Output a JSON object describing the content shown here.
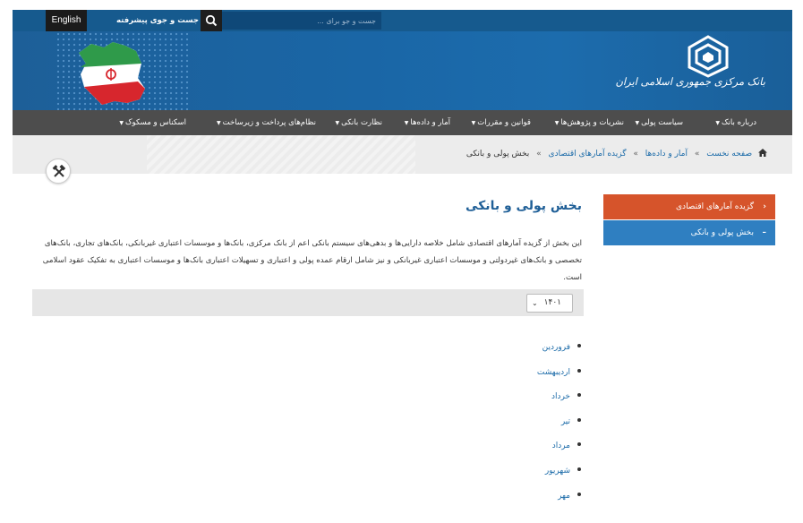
{
  "topbar": {
    "language_label": "English",
    "advanced_search_label": "جست و جوی پیشرفته",
    "search_placeholder": "جست و جو برای ..."
  },
  "header": {
    "logo_text": "بانک مرکزی جمهوری اسلامی ایران"
  },
  "nav": {
    "items": [
      {
        "label": "درباره بانک"
      },
      {
        "label": "سیاست پولی"
      },
      {
        "label": "نشریات و پژوهش‌ها"
      },
      {
        "label": "قوانین و مقررات"
      },
      {
        "label": "آمار و داده‌ها"
      },
      {
        "label": "نظارت بانکی"
      },
      {
        "label": "نظام‌های پرداخت و زیرساخت"
      },
      {
        "label": "اسکناس و مسکوک"
      }
    ]
  },
  "breadcrumb": {
    "home": "صفحه نخست",
    "level1": "آمار و داده‌ها",
    "level2": "گزیده آمارهای اقتصادی",
    "current": "بخش پولی و بانکی",
    "separator": "»"
  },
  "sidebar": {
    "parent_label": "گزیده آمارهای اقتصادی",
    "active_label": "بخش پولی و بانکی"
  },
  "main": {
    "title": "بخش پولی و بانکی",
    "description": "این بخش از گزیده آمارهای اقتصادی شامل خلاصه دارایی‌ها و بدهی‌های سیستم بانکی اعم از بانک مرکزی، بانک‌ها و موسسات اعتباری غیربانکی، بانک‌های تجاری، بانک‌های تخصصی و بانک‌های غیردولتی و موسسات اعتباری غیربانکی و نیز شامل ارقام عمده پولی و اعتباری و تسهیلات اعتباری بانک‌ها و موسسات اعتباری به تفکیک عقود اسلامی است.",
    "year_selected": "۱۴۰۱",
    "months": [
      "فروردین",
      "اردیبهشت",
      "خرداد",
      "تیر",
      "مرداد",
      "شهریور",
      "مهر"
    ]
  },
  "colors": {
    "topbar": "#165a8e",
    "nav": "#4d4d4d",
    "sidebar_primary": "#d6542b",
    "sidebar_secondary": "#2f7fc1",
    "link": "#1a6aa8"
  }
}
